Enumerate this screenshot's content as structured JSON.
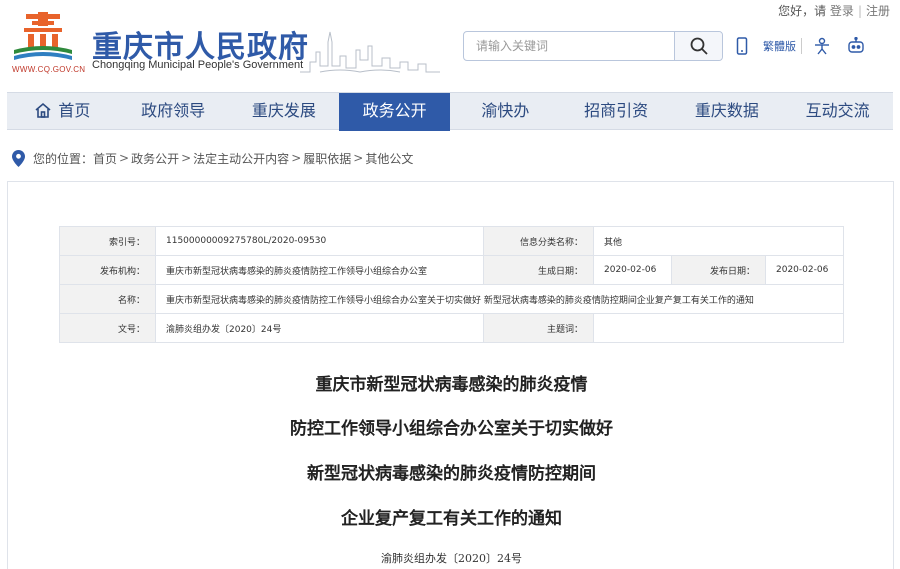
{
  "header": {
    "site_title": "重庆市人民政府",
    "site_subtitle": "Chongqing Municipal People's Government",
    "site_url": "WWW.CQ.GOV.CN",
    "greeting": "您好，请",
    "login": "登录",
    "register": "注册",
    "search_placeholder": "请输入关键词",
    "traditional": "繁體版",
    "icons": [
      "mobile-icon",
      "elderly-mode-icon",
      "robot-icon",
      "search-icon"
    ],
    "brand_color": "#2f5aa8",
    "logo_color": "#e8632b"
  },
  "nav": {
    "items": [
      {
        "label": "首页"
      },
      {
        "label": "政府领导"
      },
      {
        "label": "重庆发展"
      },
      {
        "label": "政务公开"
      },
      {
        "label": "渝快办"
      },
      {
        "label": "招商引资"
      },
      {
        "label": "重庆数据"
      },
      {
        "label": "互动交流"
      }
    ],
    "active_index": 3
  },
  "breadcrumb": {
    "prefix": "您的位置：",
    "items": [
      "首页",
      "政务公开",
      "法定主动公开内容",
      "履职依据",
      "其他公文"
    ],
    "separator": ">"
  },
  "info": {
    "index_label": "索引号：",
    "index_value": "11500000009275780L/2020-09530",
    "category_label": "信息分类名称：",
    "category_value": "其他",
    "publisher_label": "发布机构：",
    "publisher_value": "重庆市新型冠状病毒感染的肺炎疫情防控工作领导小组综合办公室",
    "created_label": "生成日期：",
    "created_value": "2020-02-06",
    "published_label": "发布日期：",
    "published_value": "2020-02-06",
    "name_label": "名称：",
    "name_value": "重庆市新型冠状病毒感染的肺炎疫情防控工作领导小组综合办公室关于切实做好 新型冠状病毒感染的肺炎疫情防控期间企业复产复工有关工作的通知",
    "docno_label": "文号：",
    "docno_value": "渝肺炎组办发〔2020〕24号",
    "subject_label": "主题词：",
    "subject_value": ""
  },
  "document": {
    "title_lines": [
      "重庆市新型冠状病毒感染的肺炎疫情",
      "防控工作领导小组综合办公室关于切实做好",
      "新型冠状病毒感染的肺炎疫情防控期间",
      "企业复产复工有关工作的通知"
    ],
    "doc_number": "渝肺炎组办发〔2020〕24号"
  }
}
